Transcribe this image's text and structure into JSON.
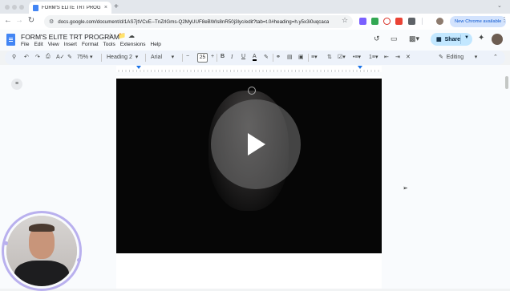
{
  "browser": {
    "tab_title": "FORM'S ELITE TRT PROGRAM",
    "tab_close": "×",
    "new_tab": "+",
    "url": "docs.google.com/document/d/1AS7jtVCvE--TnZrlGms-Q2MyUUF8eBWIs8nR50j3lyc/edit?tab=t.0#heading=h.y5x3i0uqcaca",
    "new_chrome_label": "New Chrome available",
    "tab_menu": "⌄"
  },
  "docs": {
    "title": "FORM'S ELITE TRT PROGRAM",
    "menu": [
      "File",
      "Edit",
      "View",
      "Insert",
      "Format",
      "Tools",
      "Extensions",
      "Help"
    ],
    "share_label": "Share"
  },
  "toolbar": {
    "zoom": "75%",
    "style": "Heading 2",
    "font": "Arial",
    "font_size": "25",
    "mode": "Editing"
  },
  "colors": {
    "accent": "#1a73e8",
    "share_bg": "#c2e7ff",
    "video_bg": "#060606",
    "webcam_ring": "#b9b0ee"
  },
  "icons": {
    "star": "star-icon",
    "move": "folder-icon",
    "cloud": "cloud-icon",
    "history": "history-icon",
    "comment": "comment-icon",
    "meet": "video-call-icon",
    "gemini": "sparkle-icon",
    "play": "play-icon"
  }
}
